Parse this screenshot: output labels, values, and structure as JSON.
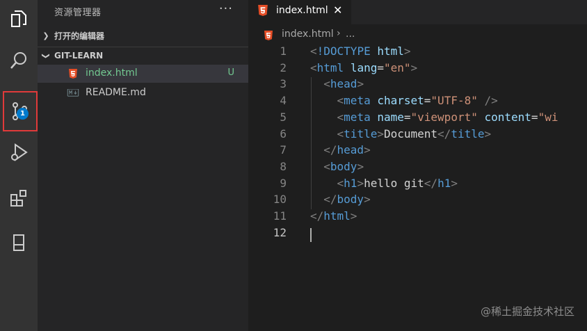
{
  "explorer": {
    "title": "资源管理器",
    "more": "···",
    "open_editors_label": "打开的编辑器",
    "folder_label": "GIT-LEARN",
    "files": [
      {
        "name": "index.html",
        "status": "U"
      },
      {
        "name": "README.md",
        "status": ""
      }
    ]
  },
  "activity": {
    "scm_badge": "1"
  },
  "tab": {
    "label": "index.html",
    "close": "✕"
  },
  "breadcrumb": {
    "file": "index.html",
    "separator": "›",
    "more": "..."
  },
  "editor": {
    "line_numbers": [
      "1",
      "2",
      "3",
      "4",
      "5",
      "6",
      "7",
      "8",
      "9",
      "10",
      "11",
      "12"
    ],
    "lines": [
      "<!DOCTYPE html>",
      "<html lang=\"en\">",
      "  <head>",
      "    <meta charset=\"UTF-8\" />",
      "    <meta name=\"viewport\" content=\"wi",
      "    <title>Document</title>",
      "  </head>",
      "  <body>",
      "    <h1>hello git</h1>",
      "  </body>",
      "</html>",
      ""
    ]
  },
  "watermark": "@稀土掘金技术社区",
  "colors": {
    "untracked": "#73c991",
    "badge": "#007acc",
    "highlight_outline": "#e03a3a",
    "html_icon": "#e44d26"
  }
}
